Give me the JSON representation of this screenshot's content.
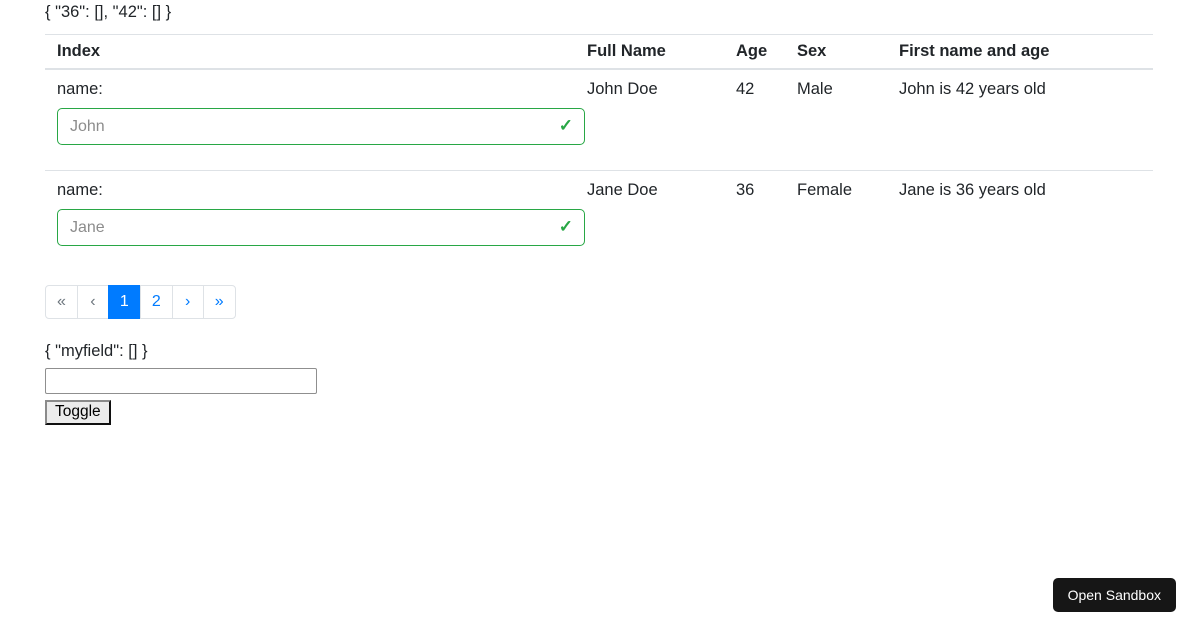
{
  "page": {
    "top_json_text": "{ \"36\": [], \"42\": [] }",
    "bottom_json_text": "{ \"myfield\": [] }"
  },
  "table": {
    "headers": [
      "Index",
      "Full Name",
      "Age",
      "Sex",
      "First name and age"
    ],
    "rows": [
      {
        "field_label": "name:",
        "input_value": "John",
        "full_name": "John Doe",
        "age": "42",
        "sex": "Male",
        "first_name_and_age": "John is 42 years old"
      },
      {
        "field_label": "name:",
        "input_value": "Jane",
        "full_name": "Jane Doe",
        "age": "36",
        "sex": "Female",
        "first_name_and_age": "Jane is 36 years old"
      }
    ]
  },
  "icons": {
    "valid_check": "✓"
  },
  "pagination": {
    "first_label": "«",
    "prev_label": "‹",
    "pages": [
      "1",
      "2"
    ],
    "active_page": "1",
    "next_label": "›",
    "last_label": "»"
  },
  "form": {
    "myfield_value": "",
    "toggle_button_label": "Toggle"
  },
  "footer": {
    "open_sandbox_label": "Open Sandbox"
  },
  "colors": {
    "success_green": "#28a745",
    "link_blue": "#007bff",
    "active_page_bg": "#007bff",
    "table_border": "#dee2e6",
    "text_dark": "#212529",
    "disabled_gray": "#6c757d",
    "sandbox_button_bg": "#161616"
  }
}
